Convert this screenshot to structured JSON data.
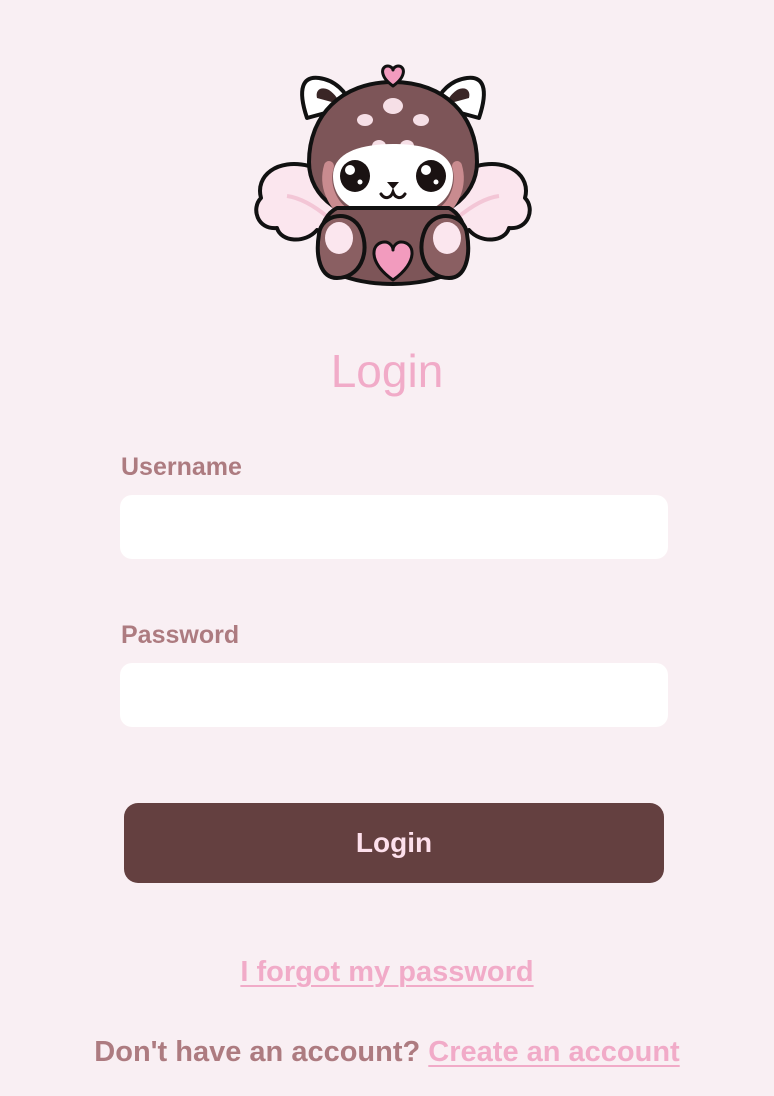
{
  "login": {
    "title": "Login",
    "username_label": "Username",
    "username_value": "",
    "password_label": "Password",
    "password_value": "",
    "submit_label": "Login",
    "forgot_link": "I forgot my password",
    "signup_prompt": "Don't have an account?",
    "signup_link": "Create an account"
  },
  "mascot": {
    "icon": "red-panda-mascot-icon"
  },
  "colors": {
    "background": "#f9eff3",
    "accent_pink": "#f1abc8",
    "label_mauve": "#ad7b80",
    "button_brown": "#644040",
    "button_text": "#fde0ec"
  }
}
